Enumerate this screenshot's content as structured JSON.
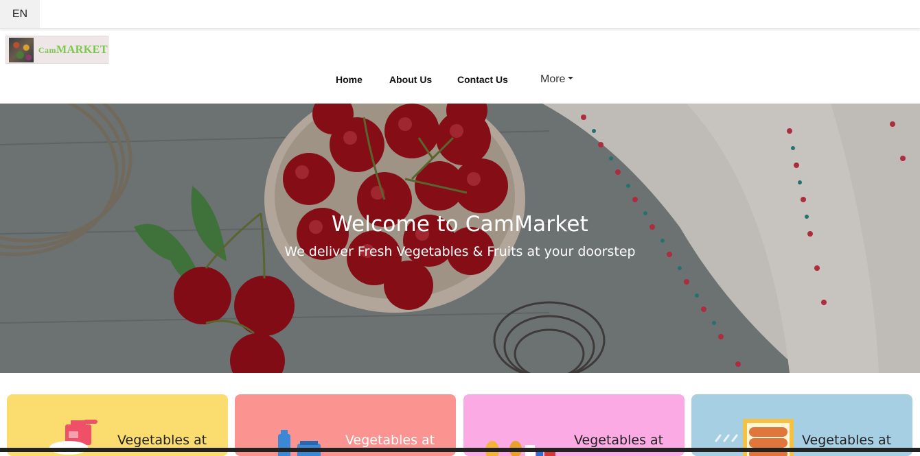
{
  "language": {
    "current": "EN"
  },
  "brand": {
    "logo_small": "Cam",
    "logo_big": "MARKET"
  },
  "nav": {
    "items": [
      "Home",
      "About Us",
      "Contact Us"
    ],
    "more": "More"
  },
  "hero": {
    "title": "Welcome to CamMarket",
    "subtitle": "We deliver Fresh Vegetables & Fruits at your doorstep"
  },
  "cards": [
    {
      "label": "Vegetables at",
      "color": "#fbdd6f",
      "text_color": "#222222",
      "icon": "hand-soap-icon"
    },
    {
      "label": "Vegetables at",
      "color": "#fb9391",
      "text_color": "#ffffff",
      "icon": "bottles-icon"
    },
    {
      "label": "Vegetables at",
      "color": "#fbaae4",
      "text_color": "#222222",
      "icon": "groceries-icon"
    },
    {
      "label": "Vegetables at",
      "color": "#a7cfe4",
      "text_color": "#222222",
      "icon": "sausages-icon"
    }
  ]
}
